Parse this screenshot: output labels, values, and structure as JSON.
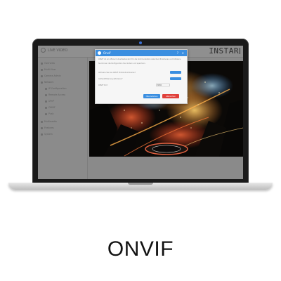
{
  "app": {
    "brand": "LIVE VIDEO",
    "logo_text": "INSTAR"
  },
  "sidebar": {
    "items": [
      {
        "label": "Overview"
      },
      {
        "label": "Multi-View"
      },
      {
        "label": "Camera Admin"
      },
      {
        "label": "Network"
      },
      {
        "label": "IP Configuration"
      },
      {
        "label": "Remote Access"
      },
      {
        "label": "UPnP"
      },
      {
        "label": "ONVIF"
      },
      {
        "label": "Push"
      },
      {
        "label": "Multimedia"
      },
      {
        "label": "Features"
      },
      {
        "label": "System"
      }
    ]
  },
  "modal": {
    "title": "Onvif",
    "body_line1": "ONVIF ist ein offener Industriestandard für die Kommunikation zwischen IP-Kameras und Software.",
    "body_line2": "Sie können die Konfiguration hier ändern und speichern.",
    "row1_label": "Aktiviere Sie das ONVIF Protokoll aktivieren?",
    "row2_label": "Authentifizierung aktivieren?",
    "row3_label": "ONVIF Port",
    "row3_value": "8080",
    "save_label": "Übernehmen",
    "cancel_label": "Abbrechen"
  },
  "caption": "ONVIF",
  "colors": {
    "accent": "#3a8ee0",
    "cancel": "#e0403a",
    "video_bg": "#0d0a08"
  }
}
